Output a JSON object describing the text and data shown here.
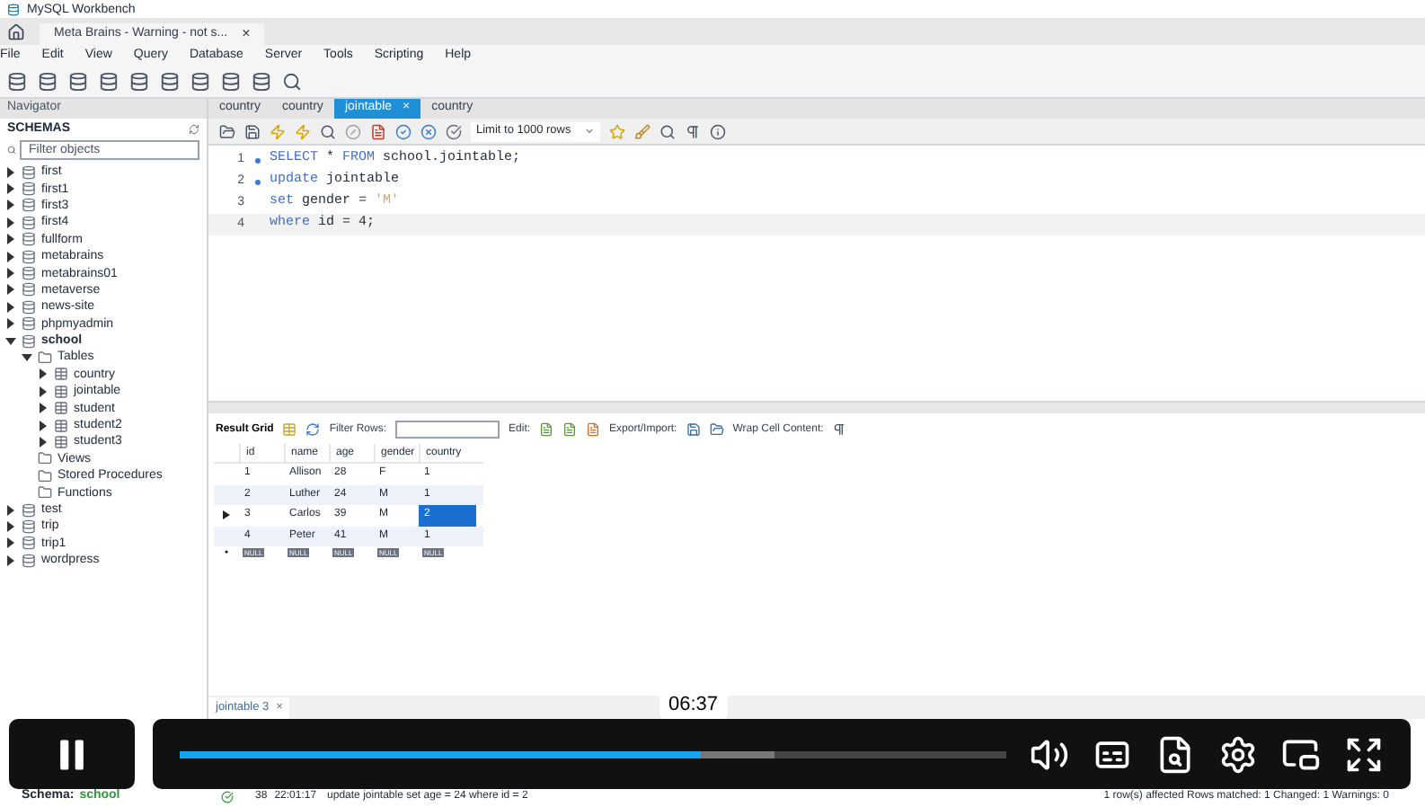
{
  "window": {
    "title": "MySQL Workbench"
  },
  "connection_tab": {
    "label": "Meta Brains - Warning - not s...",
    "close": "×"
  },
  "menu": [
    "File",
    "Edit",
    "View",
    "Query",
    "Database",
    "Server",
    "Tools",
    "Scripting",
    "Help"
  ],
  "navigator": {
    "title": "Navigator",
    "section": "SCHEMAS",
    "filter": {
      "placeholder": "Filter objects"
    },
    "tree": [
      {
        "label": "first",
        "kind": "schema",
        "expanded": false,
        "bold": false
      },
      {
        "label": "first1",
        "kind": "schema",
        "expanded": false,
        "bold": false
      },
      {
        "label": "first3",
        "kind": "schema",
        "expanded": false,
        "bold": false
      },
      {
        "label": "first4",
        "kind": "schema",
        "expanded": false,
        "bold": false
      },
      {
        "label": "fullform",
        "kind": "schema",
        "expanded": false,
        "bold": false
      },
      {
        "label": "metabrains",
        "kind": "schema",
        "expanded": false,
        "bold": false
      },
      {
        "label": "metabrains01",
        "kind": "schema",
        "expanded": false,
        "bold": false
      },
      {
        "label": "metaverse",
        "kind": "schema",
        "expanded": false,
        "bold": false
      },
      {
        "label": "news-site",
        "kind": "schema",
        "expanded": false,
        "bold": false
      },
      {
        "label": "phpmyadmin",
        "kind": "schema",
        "expanded": false,
        "bold": false
      },
      {
        "label": "school",
        "kind": "schema",
        "expanded": true,
        "bold": true,
        "children": [
          {
            "label": "Tables",
            "kind": "folder",
            "expanded": true,
            "bold": false,
            "children": [
              {
                "label": "country",
                "kind": "table",
                "expanded": false,
                "bold": false
              },
              {
                "label": "jointable",
                "kind": "table",
                "expanded": false,
                "bold": false
              },
              {
                "label": "student",
                "kind": "table",
                "expanded": false,
                "bold": false
              },
              {
                "label": "student2",
                "kind": "table",
                "expanded": false,
                "bold": false
              },
              {
                "label": "student3",
                "kind": "table",
                "expanded": false,
                "bold": false
              }
            ]
          },
          {
            "label": "Views",
            "kind": "folder",
            "bold": false
          },
          {
            "label": "Stored Procedures",
            "kind": "folder",
            "bold": false
          },
          {
            "label": "Functions",
            "kind": "folder",
            "bold": false
          }
        ]
      },
      {
        "label": "test",
        "kind": "schema",
        "expanded": false,
        "bold": false
      },
      {
        "label": "trip",
        "kind": "schema",
        "expanded": false,
        "bold": false
      },
      {
        "label": "trip1",
        "kind": "schema",
        "expanded": false,
        "bold": false
      },
      {
        "label": "wordpress",
        "kind": "schema",
        "expanded": false,
        "bold": false
      }
    ]
  },
  "query_tabs": [
    {
      "label": "country",
      "selected": false
    },
    {
      "label": "country",
      "selected": false
    },
    {
      "label": "jointable",
      "selected": true,
      "close": "×"
    },
    {
      "label": "country",
      "selected": false
    }
  ],
  "limit_select": {
    "value": "Limit to 1000 rows"
  },
  "editor": {
    "lines": [
      {
        "number": "1",
        "executed": true,
        "current": false,
        "tokens": [
          {
            "text": "SELECT",
            "kind": "keyword"
          },
          {
            "text": " * ",
            "kind": "plain"
          },
          {
            "text": "FROM",
            "kind": "keyword"
          },
          {
            "text": " school.jointable;",
            "kind": "plain"
          }
        ]
      },
      {
        "number": "2",
        "executed": true,
        "current": false,
        "tokens": [
          {
            "text": "update",
            "kind": "keyword"
          },
          {
            "text": " jointable",
            "kind": "plain"
          }
        ]
      },
      {
        "number": "3",
        "executed": false,
        "current": false,
        "tokens": [
          {
            "text": "set",
            "kind": "keyword"
          },
          {
            "text": " gender = ",
            "kind": "plain"
          },
          {
            "text": "'M'",
            "kind": "string"
          }
        ]
      },
      {
        "number": "4",
        "executed": false,
        "current": true,
        "tokens": [
          {
            "text": "where",
            "kind": "keyword"
          },
          {
            "text": " id = 4;",
            "kind": "plain"
          }
        ]
      }
    ]
  },
  "result_toolbar": {
    "result_grid": "Result Grid",
    "filter_label": "Filter Rows:",
    "edit_label": "Edit:",
    "export_label": "Export/Import:",
    "wrap_label": "Wrap Cell Content:"
  },
  "grid": {
    "columns": [
      "id",
      "name",
      "age",
      "gender",
      "country"
    ],
    "rows": [
      {
        "current": false,
        "cells": [
          {
            "text": "1",
            "selected": false
          },
          {
            "text": "Allison",
            "selected": false
          },
          {
            "text": "28",
            "selected": false
          },
          {
            "text": "F",
            "selected": false
          },
          {
            "text": "1",
            "selected": false
          }
        ]
      },
      {
        "current": false,
        "cells": [
          {
            "text": "2",
            "selected": false
          },
          {
            "text": "Luther",
            "selected": false
          },
          {
            "text": "24",
            "selected": false
          },
          {
            "text": "M",
            "selected": false
          },
          {
            "text": "1",
            "selected": false
          }
        ]
      },
      {
        "current": true,
        "cells": [
          {
            "text": "3",
            "selected": false
          },
          {
            "text": "Carlos",
            "selected": false
          },
          {
            "text": "39",
            "selected": false
          },
          {
            "text": "M",
            "selected": false
          },
          {
            "text": "2",
            "selected": true
          }
        ]
      },
      {
        "current": false,
        "cells": [
          {
            "text": "4",
            "selected": false
          },
          {
            "text": "Peter",
            "selected": false
          },
          {
            "text": "41",
            "selected": false
          },
          {
            "text": "M",
            "selected": false
          },
          {
            "text": "1",
            "selected": false
          }
        ]
      }
    ],
    "new_row": {
      "marker": "•",
      "cells": [
        "NULL",
        "NULL",
        "NULL",
        "NULL",
        "NULL"
      ]
    }
  },
  "result_tab": {
    "label": "jointable 3",
    "close": "×"
  },
  "schema_status": {
    "label": "Schema:",
    "value": "school"
  },
  "output_row": {
    "number": "38",
    "time": "22:01:17",
    "action": "update jointable set age = 24 where id = 2",
    "message": "1 row(s) affected Rows matched: 1  Changed: 1  Warnings: 0"
  },
  "player": {
    "playing": true,
    "time_tooltip": "06:37",
    "progress": {
      "level": 0.63,
      "buffered": {
        "level": 0.72
      }
    }
  }
}
